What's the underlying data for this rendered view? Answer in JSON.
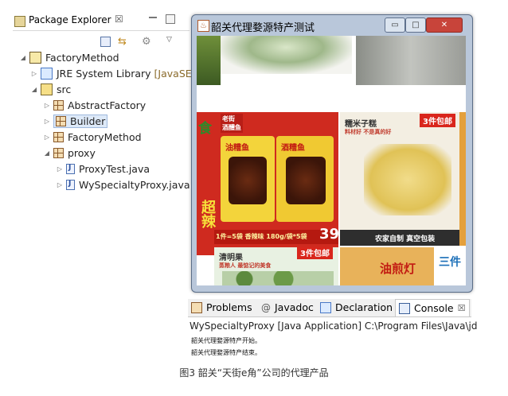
{
  "package_explorer": {
    "title": "Package Explorer",
    "tab_close": "☒",
    "tree": [
      {
        "label": "FactoryMethod",
        "icon": "project-icon"
      },
      {
        "label": "JRE System Library",
        "suffix": "[JavaSE-",
        "icon": "library-icon"
      },
      {
        "label": "src",
        "icon": "source-folder-icon"
      },
      {
        "label": "AbstractFactory",
        "icon": "package-icon"
      },
      {
        "label": "Builder",
        "icon": "package-icon"
      },
      {
        "label": "FactoryMethod",
        "icon": "package-icon"
      },
      {
        "label": "proxy",
        "icon": "package-icon"
      },
      {
        "label": "ProxyTest.java",
        "icon": "java-file-icon"
      },
      {
        "label": "WySpecialtyProxy.java",
        "icon": "java-file-icon"
      }
    ]
  },
  "window": {
    "title": "韶关代理婺源特产测试",
    "minimize": "▭",
    "maximize": "□",
    "close": "✕",
    "products": {
      "tile1_left": "食",
      "tile1_badge": "老街\n酒醴鱼",
      "tile1_brand1": "油糟鱼",
      "tile1_brand2": "酒糟鱼",
      "tile1_side": "超辣",
      "tile1_strip": "1件=5袋 香辣味 180g/袋*5袋",
      "tile1_price": "39",
      "tile2_name": "糯米子糕",
      "tile2_sub": "料材好 不是真的好",
      "tile2_ribbon": "3件包邮",
      "tile2_strip": "农家自制 真空包装",
      "tile3_name": "清明果",
      "tile3_sub": "蒸粮人 最惦记的美食",
      "tile3_ribbon": "3件包邮",
      "tile4_text": "油煎灯",
      "tile5_text": "三件"
    }
  },
  "console_tabs": [
    {
      "label": "Problems",
      "icon": "problems-icon"
    },
    {
      "label": "Javadoc",
      "icon": "javadoc-icon"
    },
    {
      "label": "Declaration",
      "icon": "declaration-icon"
    },
    {
      "label": "Console",
      "icon": "console-icon",
      "close": "☒"
    }
  ],
  "console": {
    "app_line": "WySpecialtyProxy [Java Application] C:\\Program Files\\Java\\jd",
    "output": [
      "韶关代理婺源特产开始。",
      "韶关代理婺源特产结束。"
    ]
  },
  "caption": "图3 韶关“天街e角”公司的代理产品",
  "colors": {
    "accent": "#4a79c7",
    "selection": "#dde9f8",
    "window_frame": "#b9c7da",
    "close_button": "#c8443a"
  }
}
